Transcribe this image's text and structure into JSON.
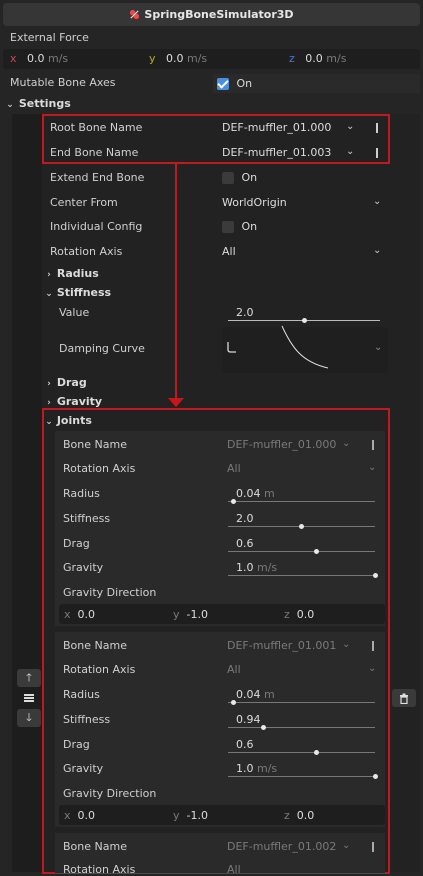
{
  "header": {
    "title": "SpringBoneSimulator3D",
    "icon": "spring-bone-icon",
    "accent": "#e84a4a"
  },
  "external_force": {
    "label": "External Force",
    "x": {
      "axis": "x",
      "value": "0.0",
      "unit": "m/s"
    },
    "y": {
      "axis": "y",
      "value": "0.0",
      "unit": "m/s"
    },
    "z": {
      "axis": "z",
      "value": "0.0",
      "unit": "m/s"
    }
  },
  "mutable_bone_axes": {
    "label": "Mutable Bone Axes",
    "value": "On"
  },
  "settings": {
    "label": "Settings",
    "root_bone_name": {
      "label": "Root Bone Name",
      "value": "DEF-muffler_01.000"
    },
    "end_bone_name": {
      "label": "End Bone Name",
      "value": "DEF-muffler_01.003"
    },
    "extend_end_bone": {
      "label": "Extend End Bone",
      "value": "On"
    },
    "center_from": {
      "label": "Center From",
      "value": "WorldOrigin"
    },
    "individual_config": {
      "label": "Individual Config",
      "value": "On"
    },
    "rotation_axis": {
      "label": "Rotation Axis",
      "value": "All"
    },
    "radius": {
      "label": "Radius"
    },
    "stiffness": {
      "label": "Stiffness",
      "value_label": "Value",
      "value": "2.0",
      "value_fraction": 0.5,
      "damping_curve_label": "Damping Curve"
    },
    "drag": {
      "label": "Drag"
    },
    "gravity": {
      "label": "Gravity"
    }
  },
  "joints": {
    "label": "Joints",
    "field_labels": {
      "bone_name": "Bone Name",
      "rotation_axis": "Rotation Axis",
      "radius": "Radius",
      "stiffness": "Stiffness",
      "drag": "Drag",
      "gravity": "Gravity",
      "gravity_direction": "Gravity Direction"
    },
    "items": [
      {
        "bone_name": "DEF-muffler_01.000",
        "rotation_axis": "All",
        "radius": "0.04",
        "radius_unit": "m",
        "radius_fraction": 0.04,
        "stiffness": "2.0",
        "stiffness_fraction": 0.5,
        "drag": "0.6",
        "drag_fraction": 0.6,
        "gravity": "1.0",
        "gravity_unit": "m/s",
        "gravity_fraction": 1.0,
        "gx": "0.0",
        "gy": "-1.0",
        "gz": "0.0"
      },
      {
        "bone_name": "DEF-muffler_01.001",
        "rotation_axis": "All",
        "radius": "0.04",
        "radius_unit": "m",
        "radius_fraction": 0.04,
        "stiffness": "0.94",
        "stiffness_fraction": 0.24,
        "drag": "0.6",
        "drag_fraction": 0.6,
        "gravity": "1.0",
        "gravity_unit": "m/s",
        "gravity_fraction": 1.0,
        "gx": "0.0",
        "gy": "-1.0",
        "gz": "0.0"
      },
      {
        "bone_name": "DEF-muffler_01.002",
        "rotation_axis": "All"
      }
    ]
  },
  "axis_letters": {
    "x": "x",
    "y": "y",
    "z": "z"
  },
  "colors": {
    "highlight": "#c0191f",
    "checkbox_on": "#4d8fde"
  }
}
